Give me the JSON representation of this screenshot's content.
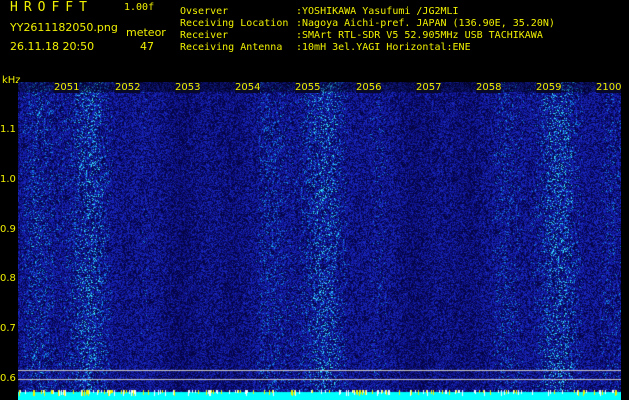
{
  "header": {
    "app_title": "HROFFT",
    "version": "1.00f",
    "filename": "YY2611182050.png",
    "meteor_label": "meteor",
    "datetime": "26.11.18 20:50",
    "meteor_count": "47"
  },
  "info": [
    {
      "label": "Ovserver",
      "value": ":YOSHIKAWA Yasufumi /JG2MLI"
    },
    {
      "label": "Receiving Location",
      "value": ":Nagoya Aichi-pref. JAPAN (136.90E, 35.20N)"
    },
    {
      "label": "Receiver",
      "value": ":SMArt RTL-SDR V5 52.905MHz USB TACHIKAWA"
    },
    {
      "label": "Receiving Antenna",
      "value": ":10mH 3el.YAGI Horizontal:ENE"
    }
  ],
  "axis": {
    "unit": "kHz",
    "y_ticks": [
      "1.1",
      "1.0",
      "0.9",
      "0.8",
      "0.7",
      "0.6"
    ],
    "x_ticks": [
      "2051",
      "2052",
      "2053",
      "2054",
      "2055",
      "2056",
      "2057",
      "2058",
      "2059",
      "2100"
    ]
  },
  "colors": {
    "text": "#f0f000",
    "background": "#000000",
    "noise_low": "#1010a0",
    "noise_high": "#00e0ff",
    "reference_line": "#c8c8c8",
    "bottom_band": "#00ffff"
  }
}
